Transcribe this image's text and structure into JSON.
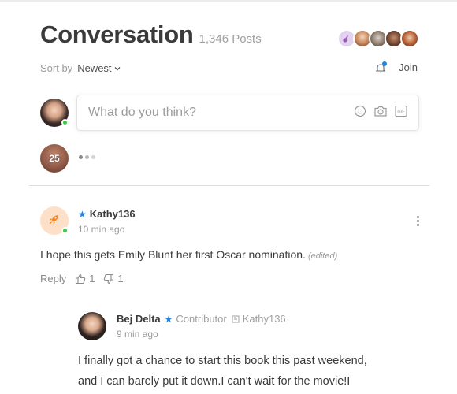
{
  "header": {
    "title": "Conversation",
    "post_count": "1,346 Posts",
    "participant_avatars": [
      "guitar-icon",
      "user-avatar",
      "user-avatar",
      "user-avatar",
      "user-avatar"
    ]
  },
  "sort": {
    "label": "Sort by",
    "value": "Newest"
  },
  "join": {
    "label": "Join"
  },
  "composer": {
    "placeholder": "What do you think?",
    "icons": [
      "emoji-icon",
      "camera-icon",
      "gif-icon"
    ]
  },
  "typing": {
    "count": "25"
  },
  "comments": [
    {
      "username": "Kathy136",
      "time": "10 min ago",
      "body": "I hope this gets Emily Blunt her first Oscar nomination.",
      "edited_label": "(edited)",
      "reply_label": "Reply",
      "likes": "1",
      "dislikes": "1"
    },
    {
      "username": "Bej Delta",
      "badge": "Contributor",
      "reply_to": "Kathy136",
      "time": "9 min ago",
      "body_line1": "I finally got a chance to start this book this past weekend,",
      "body_line2": "and I can barely put it down.I can't wait for the movie!I"
    }
  ],
  "colors": {
    "accent": "#1f84e2",
    "online": "#38c948",
    "rocket_bg": "#fde0c7",
    "rocket": "#f08a24"
  }
}
